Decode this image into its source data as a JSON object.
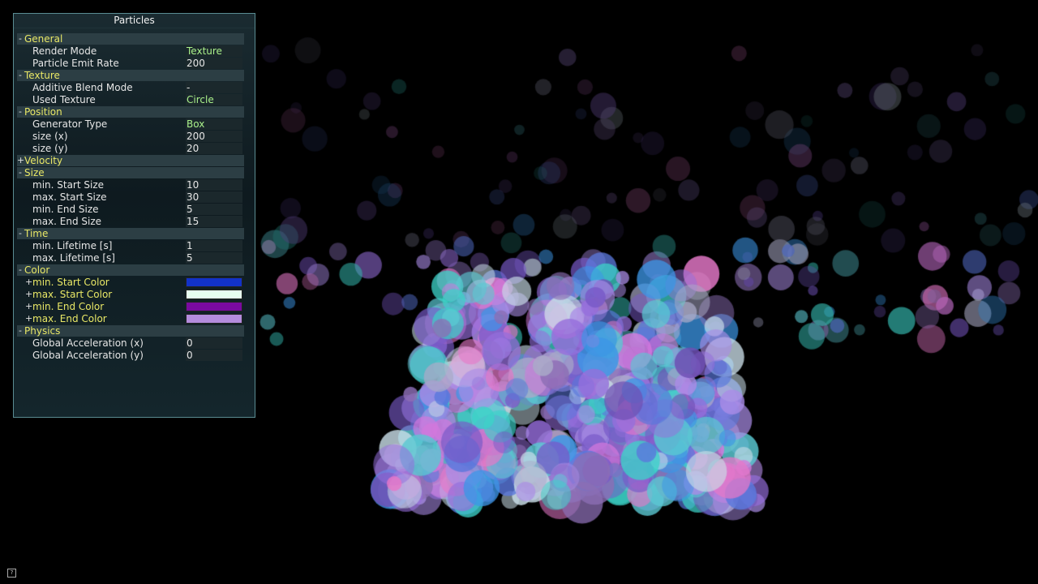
{
  "panel": {
    "title": "Particles",
    "sections": [
      {
        "key": "general",
        "label": "General",
        "toggle": "-",
        "rows": [
          {
            "name": "Render Mode",
            "value": "Texture",
            "highlight": true
          },
          {
            "name": "Particle Emit Rate",
            "value": "200",
            "highlight": false
          }
        ]
      },
      {
        "key": "texture",
        "label": "Texture",
        "toggle": "-",
        "rows": [
          {
            "name": "Additive Blend Mode",
            "value": " -",
            "highlight": false
          },
          {
            "name": "Used Texture",
            "value": "Circle",
            "highlight": true
          }
        ]
      },
      {
        "key": "position",
        "label": "Position",
        "toggle": "-",
        "rows": [
          {
            "name": "Generator Type",
            "value": "Box",
            "highlight": true
          },
          {
            "name": "size (x)",
            "value": "200",
            "highlight": false
          },
          {
            "name": "size (y)",
            "value": "20",
            "highlight": false
          }
        ]
      },
      {
        "key": "velocity",
        "label": "Velocity",
        "toggle": "+",
        "rows": []
      },
      {
        "key": "size",
        "label": "Size",
        "toggle": "-",
        "rows": [
          {
            "name": "min. Start Size",
            "value": "10",
            "highlight": false
          },
          {
            "name": "max. Start Size",
            "value": "30",
            "highlight": false
          },
          {
            "name": "min. End Size",
            "value": "5",
            "highlight": false
          },
          {
            "name": "max. End Size",
            "value": "15",
            "highlight": false
          }
        ]
      },
      {
        "key": "time",
        "label": "Time",
        "toggle": "-",
        "rows": [
          {
            "name": "min. Lifetime [s]",
            "value": "1",
            "highlight": false
          },
          {
            "name": "max. Lifetime [s]",
            "value": "5",
            "highlight": false
          }
        ]
      },
      {
        "key": "color",
        "label": "Color",
        "toggle": "-",
        "colors": [
          {
            "name": "min. Start Color",
            "toggle": "+",
            "color": "#1232c8"
          },
          {
            "name": "max. Start Color",
            "toggle": "+",
            "color": "#e6fff0"
          },
          {
            "name": "min. End Color",
            "toggle": "+",
            "color": "#7a0aa0"
          },
          {
            "name": "max. End Color",
            "toggle": "+",
            "color": "#b48cdc"
          }
        ]
      },
      {
        "key": "physics",
        "label": "Physics",
        "toggle": "-",
        "rows": [
          {
            "name": "Global Acceleration (x)",
            "value": "0",
            "highlight": false
          },
          {
            "name": "Global Acceleration (y)",
            "value": "0",
            "highlight": false
          }
        ]
      }
    ]
  },
  "help_icon": "help-icon",
  "colors": {
    "background": "#000000",
    "section_label": "#e9e866",
    "highlight_value": "#a9f08a"
  }
}
